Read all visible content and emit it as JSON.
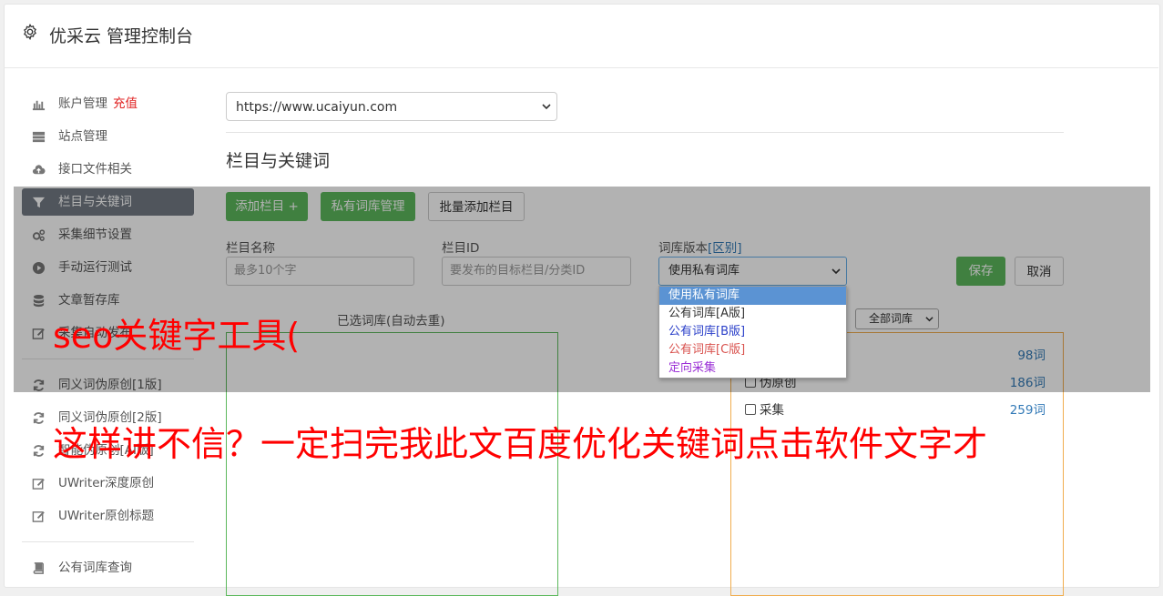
{
  "app": {
    "title": "优采云 管理控制台",
    "icon": "gear-icon"
  },
  "sidebar": {
    "items": [
      {
        "label": "账户管理",
        "badge": "充值",
        "icon": "bar-chart-icon"
      },
      {
        "label": "站点管理",
        "icon": "server-icon"
      },
      {
        "label": "接口文件相关",
        "icon": "cloud-upload-icon"
      },
      {
        "label": "栏目与关键词",
        "icon": "filter-icon",
        "active": true
      },
      {
        "label": "采集细节设置",
        "icon": "cogs-icon"
      },
      {
        "label": "手动运行测试",
        "icon": "play-circle-icon"
      },
      {
        "label": "文章暂存库",
        "icon": "database-icon"
      },
      {
        "label": "采集自动发布",
        "icon": "edit-icon"
      },
      {
        "label": "同义词伪原创[1版]",
        "icon": "refresh-icon"
      },
      {
        "label": "同义词伪原创[2版]",
        "icon": "refresh-icon"
      },
      {
        "label": "智能伪原创[AI版]",
        "icon": "refresh-icon"
      },
      {
        "label": "UWriter深度原创",
        "icon": "edit-icon"
      },
      {
        "label": "UWriter原创标题",
        "icon": "edit-icon"
      },
      {
        "label": "公有词库查询",
        "icon": "book-icon"
      }
    ]
  },
  "site_select": {
    "value": "https://www.ucaiyun.com"
  },
  "section": {
    "title": "栏目与关键词"
  },
  "toolbar": {
    "add_column": "添加栏目 +",
    "private_lib": "私有词库管理",
    "batch_add": "批量添加栏目"
  },
  "form": {
    "column_name_label": "栏目名称",
    "column_name_placeholder": "最多10个字",
    "column_id_label": "栏目ID",
    "column_id_placeholder": "要发布的目标栏目/分类ID",
    "lib_version_label": "词库版本",
    "lib_version_link": "[区别]",
    "lib_version_value": "使用私有词库",
    "save": "保存",
    "cancel": "取消"
  },
  "dropdown": {
    "options": [
      {
        "label": "使用私有词库",
        "color": "#ffffff",
        "bg": "#5b93d3"
      },
      {
        "label": "公有词库[A版]",
        "color": "#333333"
      },
      {
        "label": "公有词库[B版]",
        "color": "#2a3fc9"
      },
      {
        "label": "公有词库[C版]",
        "color": "#d9534f"
      },
      {
        "label": "定向采集",
        "color": "#9b30d6"
      }
    ]
  },
  "libs": {
    "selected_label": "已选词库(自动去重)",
    "filter_value": "全部词库",
    "rows": [
      {
        "label": "",
        "count": "98词"
      },
      {
        "label": "伪原创",
        "count": "186词"
      },
      {
        "label": "采集",
        "count": "259词"
      }
    ]
  },
  "watermark": {
    "line1": "seo关键字工具(",
    "line2": "这样讲不信？一定扫完我此文百度优化关键词点击软件文字才"
  },
  "colors": {
    "accent": "#5cb85c",
    "active_bg": "#737a84",
    "badge": "#e02020",
    "link": "#337ab7",
    "watermark": "#ff0000"
  }
}
